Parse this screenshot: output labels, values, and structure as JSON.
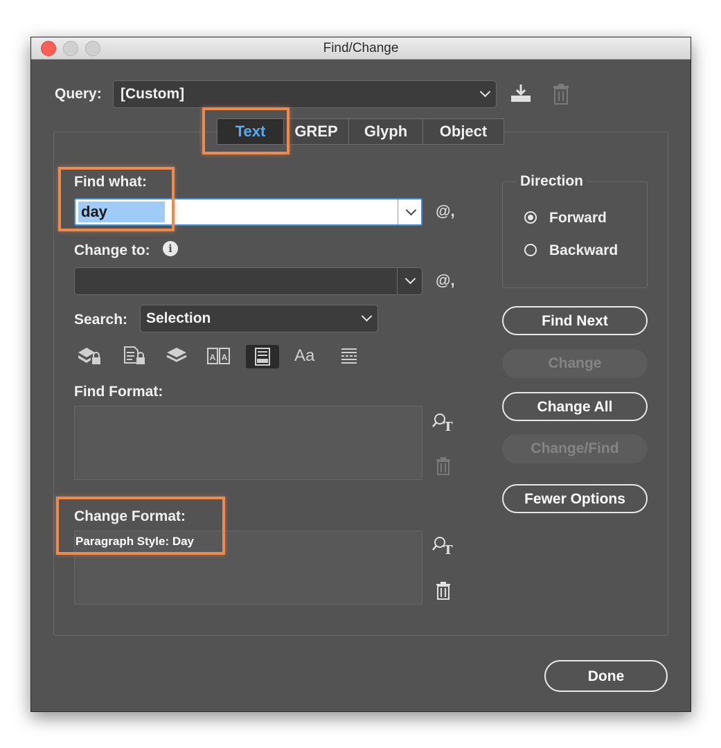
{
  "window": {
    "title": "Find/Change"
  },
  "query": {
    "label": "Query:",
    "value": "[Custom]"
  },
  "tabs": [
    {
      "label": "Text",
      "active": true
    },
    {
      "label": "GREP",
      "active": false
    },
    {
      "label": "Glyph",
      "active": false
    },
    {
      "label": "Object",
      "active": false
    }
  ],
  "find": {
    "label": "Find what:",
    "value": "day",
    "special_char_symbol": "@,"
  },
  "change": {
    "label": "Change to:",
    "info_symbol": "i",
    "value": "",
    "special_char_symbol": "@,"
  },
  "search": {
    "label": "Search:",
    "value": "Selection"
  },
  "options_icons": [
    "include-locked-layers-icon",
    "include-locked-stories-icon",
    "include-hidden-layers-icon",
    "include-master-pages-icon",
    "include-footnotes-icon",
    "case-sensitive-icon",
    "whole-word-icon"
  ],
  "case_sensitive_text": "Aa",
  "find_format": {
    "label": "Find Format:",
    "value": ""
  },
  "change_format": {
    "label": "Change Format:",
    "value": "Paragraph Style: Day"
  },
  "direction": {
    "label": "Direction",
    "forward": "Forward",
    "backward": "Backward",
    "selected": "Forward"
  },
  "buttons": {
    "find_next": "Find Next",
    "change": "Change",
    "change_all": "Change All",
    "change_find": "Change/Find",
    "fewer_options": "Fewer Options",
    "done": "Done"
  },
  "colors": {
    "window_bg": "#535353",
    "accent_text": "#5aaaf0",
    "highlight": "#ec8a4f",
    "selection": "#9ecbf7"
  }
}
